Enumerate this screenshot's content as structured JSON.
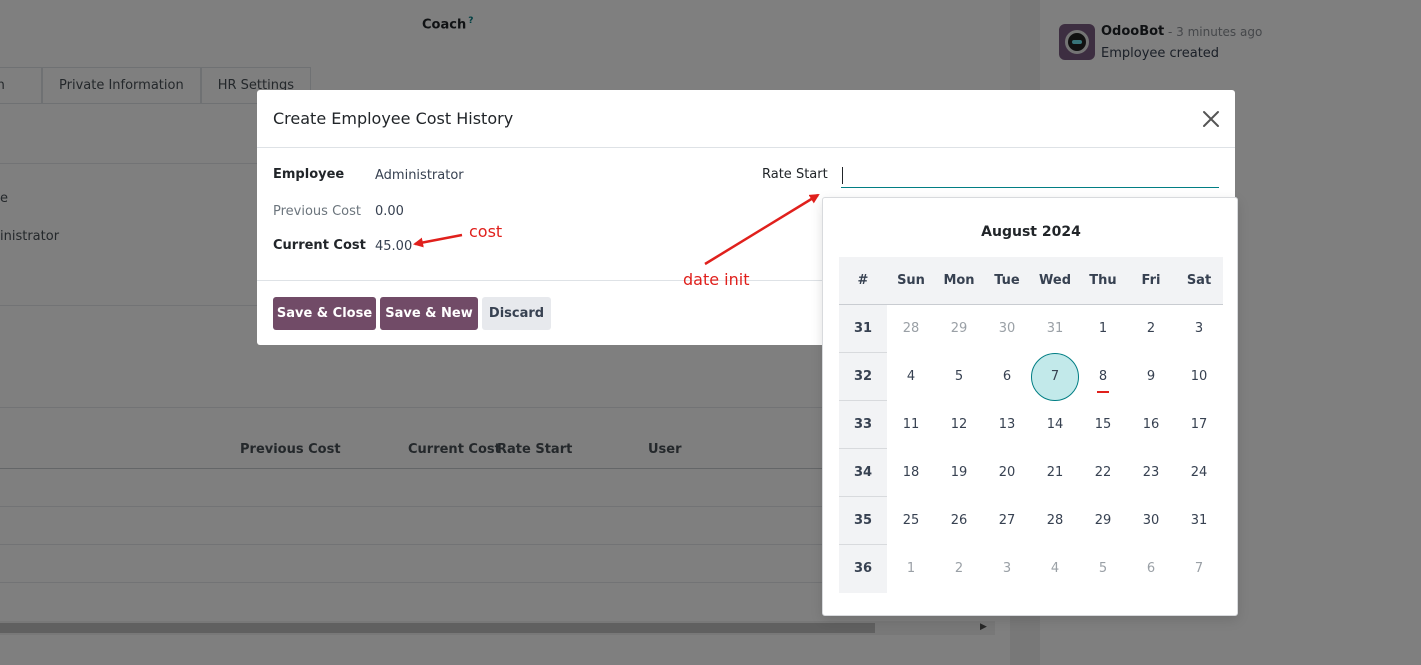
{
  "background": {
    "coach_label": "Coach",
    "help_mark": "?",
    "tabs": [
      "ation",
      "Private Information",
      "HR Settings"
    ],
    "side_fragments": [
      "e",
      "inistrator"
    ],
    "table_headers": [
      "Previous Cost",
      "Current Cost",
      "Rate Start",
      "User"
    ],
    "chatter": {
      "author": "OdooBot",
      "time": "- 3 minutes ago",
      "message": "Employee created"
    }
  },
  "modal": {
    "title": "Create Employee Cost History",
    "fields": {
      "employee_label": "Employee",
      "employee_value": "Administrator",
      "previous_cost_label": "Previous Cost",
      "previous_cost_value": "0.00",
      "current_cost_label": "Current Cost",
      "current_cost_value": "45.00",
      "rate_start_label": "Rate Start",
      "rate_start_value": ""
    },
    "buttons": {
      "save_close": "Save & Close",
      "save_new": "Save & New",
      "discard": "Discard"
    }
  },
  "annotations": {
    "cost": "cost",
    "date_init": "date init",
    "color": "#e0201c"
  },
  "datepicker": {
    "month_label": "August 2024",
    "week_header": "#",
    "weekdays": [
      "Sun",
      "Mon",
      "Tue",
      "Wed",
      "Thu",
      "Fri",
      "Sat"
    ],
    "weeks": [
      {
        "week": "31",
        "days": [
          {
            "d": "28",
            "out": true
          },
          {
            "d": "29",
            "out": true
          },
          {
            "d": "30",
            "out": true
          },
          {
            "d": "31",
            "out": true
          },
          {
            "d": "1"
          },
          {
            "d": "2"
          },
          {
            "d": "3"
          }
        ]
      },
      {
        "week": "32",
        "days": [
          {
            "d": "4"
          },
          {
            "d": "5"
          },
          {
            "d": "6"
          },
          {
            "d": "7",
            "selected": true
          },
          {
            "d": "8",
            "today": true
          },
          {
            "d": "9"
          },
          {
            "d": "10"
          }
        ]
      },
      {
        "week": "33",
        "days": [
          {
            "d": "11"
          },
          {
            "d": "12"
          },
          {
            "d": "13"
          },
          {
            "d": "14"
          },
          {
            "d": "15"
          },
          {
            "d": "16"
          },
          {
            "d": "17"
          }
        ]
      },
      {
        "week": "34",
        "days": [
          {
            "d": "18"
          },
          {
            "d": "19"
          },
          {
            "d": "20"
          },
          {
            "d": "21"
          },
          {
            "d": "22"
          },
          {
            "d": "23"
          },
          {
            "d": "24"
          }
        ]
      },
      {
        "week": "35",
        "days": [
          {
            "d": "25"
          },
          {
            "d": "26"
          },
          {
            "d": "27"
          },
          {
            "d": "28"
          },
          {
            "d": "29"
          },
          {
            "d": "30"
          },
          {
            "d": "31"
          }
        ]
      },
      {
        "week": "36",
        "days": [
          {
            "d": "1",
            "out": true
          },
          {
            "d": "2",
            "out": true
          },
          {
            "d": "3",
            "out": true
          },
          {
            "d": "4",
            "out": true
          },
          {
            "d": "5",
            "out": true
          },
          {
            "d": "6",
            "out": true
          },
          {
            "d": "7",
            "out": true
          }
        ]
      }
    ]
  },
  "colors": {
    "primary": "#714b67",
    "accent": "#017e84",
    "selected_day_bg": "#c2e9ea"
  }
}
